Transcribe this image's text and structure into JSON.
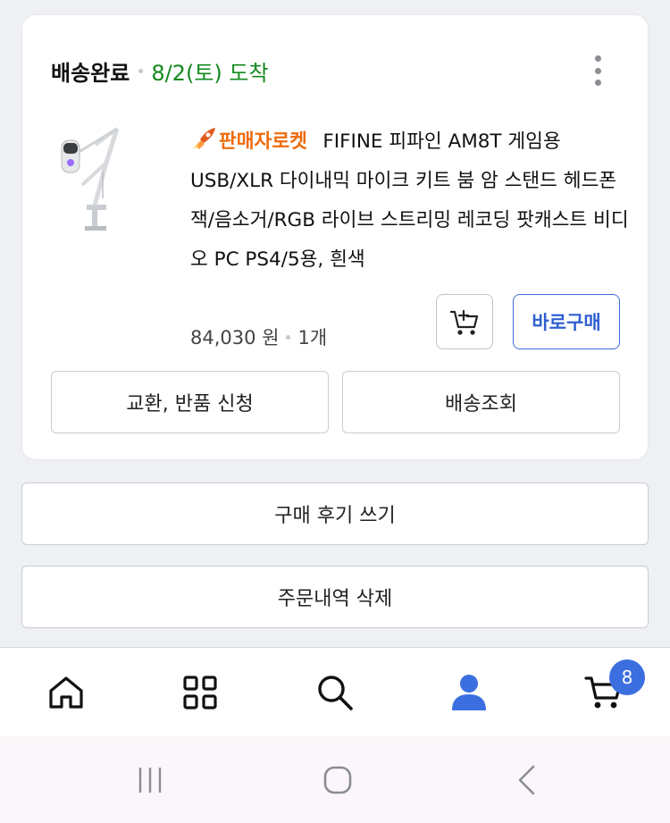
{
  "order": {
    "status": "배송완료",
    "arrival": "8/2(토) 도착",
    "product": {
      "badge": "판매자로켓",
      "title": "FIFINE 피파인 AM8T 게임용 USB/XLR 다이내믹 마이크 키트 붐 암 스탠드 헤드폰 잭/음소거/RGB 라이브 스트리밍 레코딩 팟캐스트 비디오 PC PS4/5용, 흰색",
      "price": "84,030 원",
      "quantity": "1개"
    },
    "buttons": {
      "buy_now": "바로구매",
      "exchange_return": "교환, 반품 신청",
      "tracking": "배송조회"
    }
  },
  "actions": {
    "write_review": "구매 후기 쓰기",
    "delete_order": "주문내역 삭제"
  },
  "bottom_nav": {
    "items": [
      {
        "icon": "home-icon"
      },
      {
        "icon": "category-grid-icon"
      },
      {
        "icon": "search-icon"
      },
      {
        "icon": "user-icon",
        "active": true
      },
      {
        "icon": "cart-icon"
      }
    ],
    "cart_count": "8"
  },
  "colors": {
    "accent": "#3b6fe0",
    "arrival_green": "#138a1e",
    "rocket_orange": "#ee6b0c"
  }
}
